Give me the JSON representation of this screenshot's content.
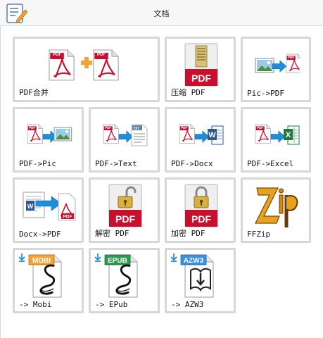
{
  "window": {
    "title": "文档"
  },
  "tiles": [
    {
      "label": "PDF合并",
      "icon": "pdf-merge-icon"
    },
    {
      "label": "压缩 PDF",
      "icon": "pdf-compress-icon"
    },
    {
      "label": "Pic->PDF",
      "icon": "pic-to-pdf-icon"
    },
    {
      "label": "PDF->Pic",
      "icon": "pdf-to-pic-icon"
    },
    {
      "label": "PDF->Text",
      "icon": "pdf-to-text-icon"
    },
    {
      "label": "PDF->Docx",
      "icon": "pdf-to-docx-icon"
    },
    {
      "label": "PDF->Excel",
      "icon": "pdf-to-excel-icon"
    },
    {
      "label": "Docx->PDF",
      "icon": "docx-to-pdf-icon"
    },
    {
      "label": "解密 PDF",
      "icon": "pdf-decrypt-icon"
    },
    {
      "label": "加密 PDF",
      "icon": "pdf-encrypt-icon"
    },
    {
      "label": "FFZip",
      "icon": "ffzip-icon"
    },
    {
      "label": "-> Mobi",
      "icon": "to-mobi-icon"
    },
    {
      "label": "-> EPub",
      "icon": "to-epub-icon"
    },
    {
      "label": "-> AZW3",
      "icon": "to-azw3-icon"
    }
  ],
  "badges": {
    "pdf": "PDF",
    "txt": "TXT",
    "word": "W",
    "excel": "X",
    "mobi": "MOBI",
    "epub": "EPUB",
    "azw3": "AZW3"
  },
  "colors": {
    "tile_border": "#d7d7d7",
    "pdf_red": "#c8102e",
    "arrow_blue": "#1e8fd6",
    "word_blue": "#2b5797",
    "excel_green": "#1f7a3c",
    "ebook_orange": "#f2a33a",
    "ebook_green": "#2e9a4f",
    "ebook_blue": "#3c8fe0"
  }
}
